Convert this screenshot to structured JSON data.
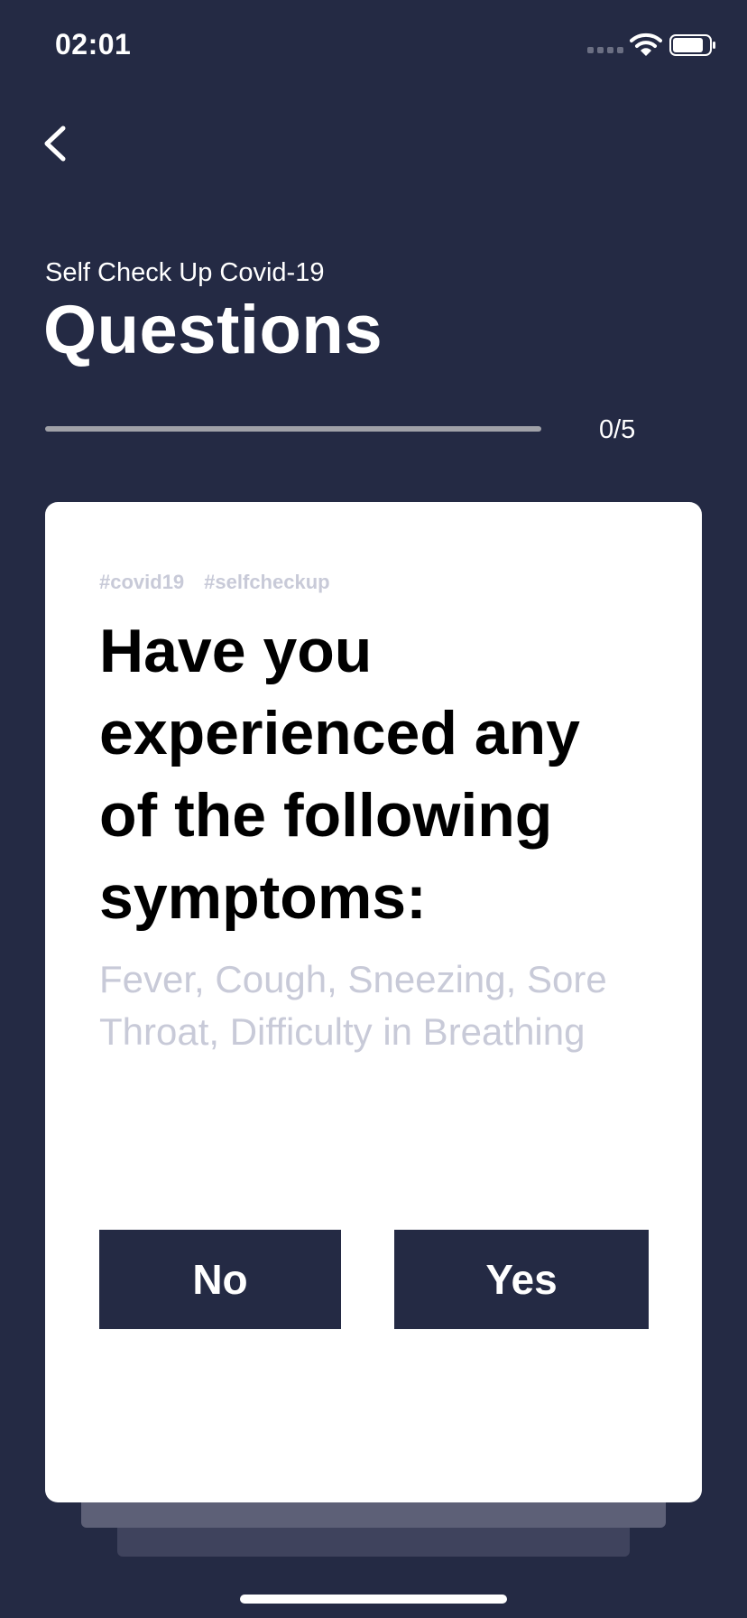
{
  "status_bar": {
    "time": "02:01"
  },
  "nav": {
    "back_icon": "chevron-left-icon"
  },
  "header": {
    "subtitle": "Self Check Up Covid-19",
    "title": "Questions"
  },
  "progress": {
    "label": "0/5",
    "fraction": 0
  },
  "card": {
    "tags": [
      "#covid19",
      "#selfcheckup"
    ],
    "question": "Have you experienced any of the following symptoms:",
    "symptoms": "Fever, Cough, Sneezing, Sore Throat, Difficulty in Breathing",
    "no_label": "No",
    "yes_label": "Yes"
  },
  "colors": {
    "background": "#242A44",
    "card": "#FFFFFF",
    "button": "#242A44",
    "muted_text": "#C8CAD8"
  }
}
